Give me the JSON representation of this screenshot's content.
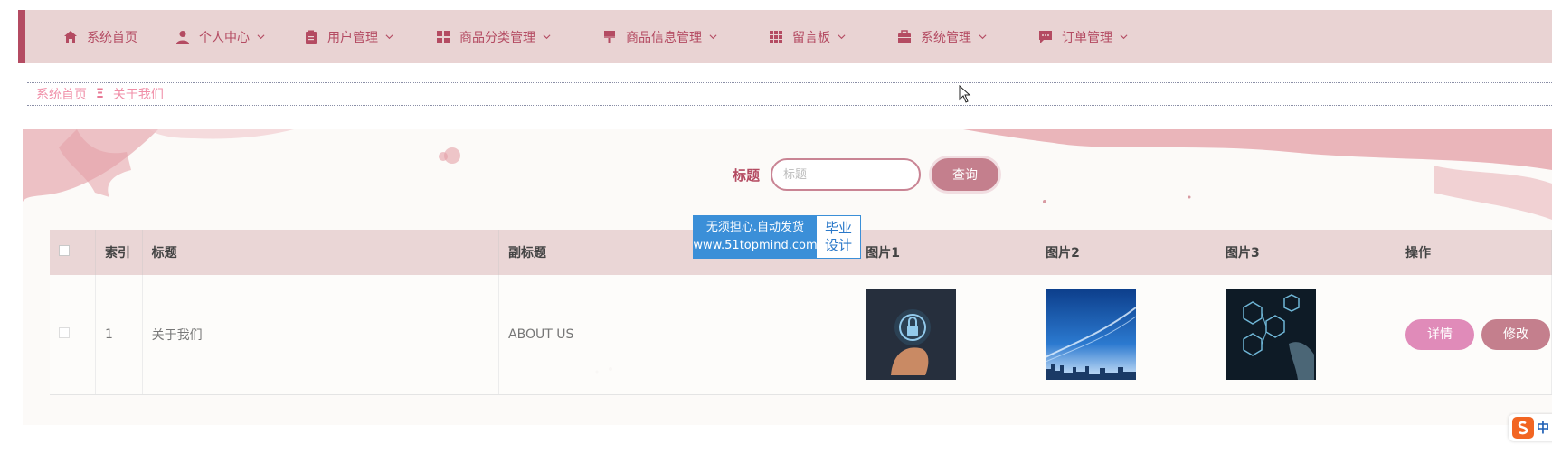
{
  "nav": {
    "items": [
      {
        "label": "系统首页",
        "icon": "home-icon",
        "dropdown": false
      },
      {
        "label": "个人中心",
        "icon": "user-icon",
        "dropdown": true
      },
      {
        "label": "用户管理",
        "icon": "clipboard-icon",
        "dropdown": true
      },
      {
        "label": "商品分类管理",
        "icon": "grid-icon",
        "dropdown": true
      },
      {
        "label": "商品信息管理",
        "icon": "brush-icon",
        "dropdown": true
      },
      {
        "label": "留言板",
        "icon": "apps-icon",
        "dropdown": true
      },
      {
        "label": "系统管理",
        "icon": "briefcase-icon",
        "dropdown": true
      },
      {
        "label": "订单管理",
        "icon": "message-icon",
        "dropdown": true
      }
    ]
  },
  "breadcrumb": {
    "home": "系统首页",
    "separator": "Ξ",
    "current": "关于我们"
  },
  "search": {
    "label": "标题",
    "placeholder": "标题",
    "value": "",
    "button": "查询"
  },
  "watermark": {
    "line1": "无须担心.自动发货",
    "line2": "www.51topmind.com",
    "right1": "毕业",
    "right2": "设计"
  },
  "table": {
    "headers": [
      "索引",
      "标题",
      "副标题",
      "图片1",
      "图片2",
      "图片3",
      "操作"
    ],
    "rows": [
      {
        "index": "1",
        "title": "关于我们",
        "subtitle": "ABOUT US",
        "images": [
          "security-image",
          "skyline-image",
          "network-image"
        ],
        "actions": [
          "详情",
          "修改"
        ]
      }
    ]
  },
  "ime": {
    "label": "中"
  },
  "colors": {
    "accent": "#b44b62",
    "nav_bg": "#e9d3d3",
    "button": "#c47f8d",
    "detail_button": "#e08bb9",
    "breadcrumb": "#f08fa8"
  }
}
